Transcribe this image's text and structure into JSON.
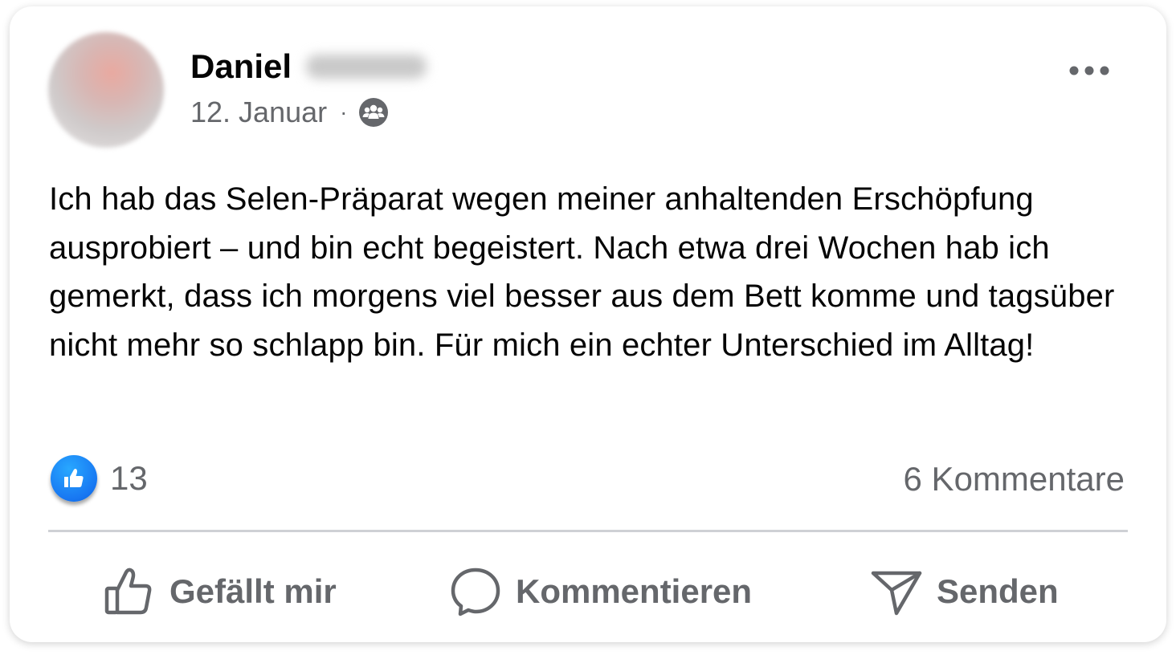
{
  "post": {
    "author_first_name": "Daniel",
    "date": "12. Januar",
    "separator": "·",
    "audience_icon": "group-icon",
    "menu_icon": "more-horizontal-icon",
    "text": "Ich hab das Selen-Präparat wegen meiner anhaltenden Erschöpfung ausprobiert – und bin echt begeistert. Nach etwa drei Wochen hab ich gemerkt, dass ich morgens viel besser aus dem Bett komme und tagsüber nicht mehr so schlapp bin. Für mich ein echter Unterschied im Alltag!"
  },
  "stats": {
    "reaction_icon": "like-icon",
    "like_count": "13",
    "comments": "6 Kommentare"
  },
  "actions": {
    "like": {
      "label": "Gefällt mir",
      "icon": "thumbs-up-icon"
    },
    "comment": {
      "label": "Kommentieren",
      "icon": "comment-bubble-icon"
    },
    "send": {
      "label": "Senden",
      "icon": "send-icon"
    }
  },
  "colors": {
    "text_primary": "#050505",
    "text_secondary": "#65676b",
    "like_blue": "#1877f2",
    "divider": "#cfd1d5"
  }
}
